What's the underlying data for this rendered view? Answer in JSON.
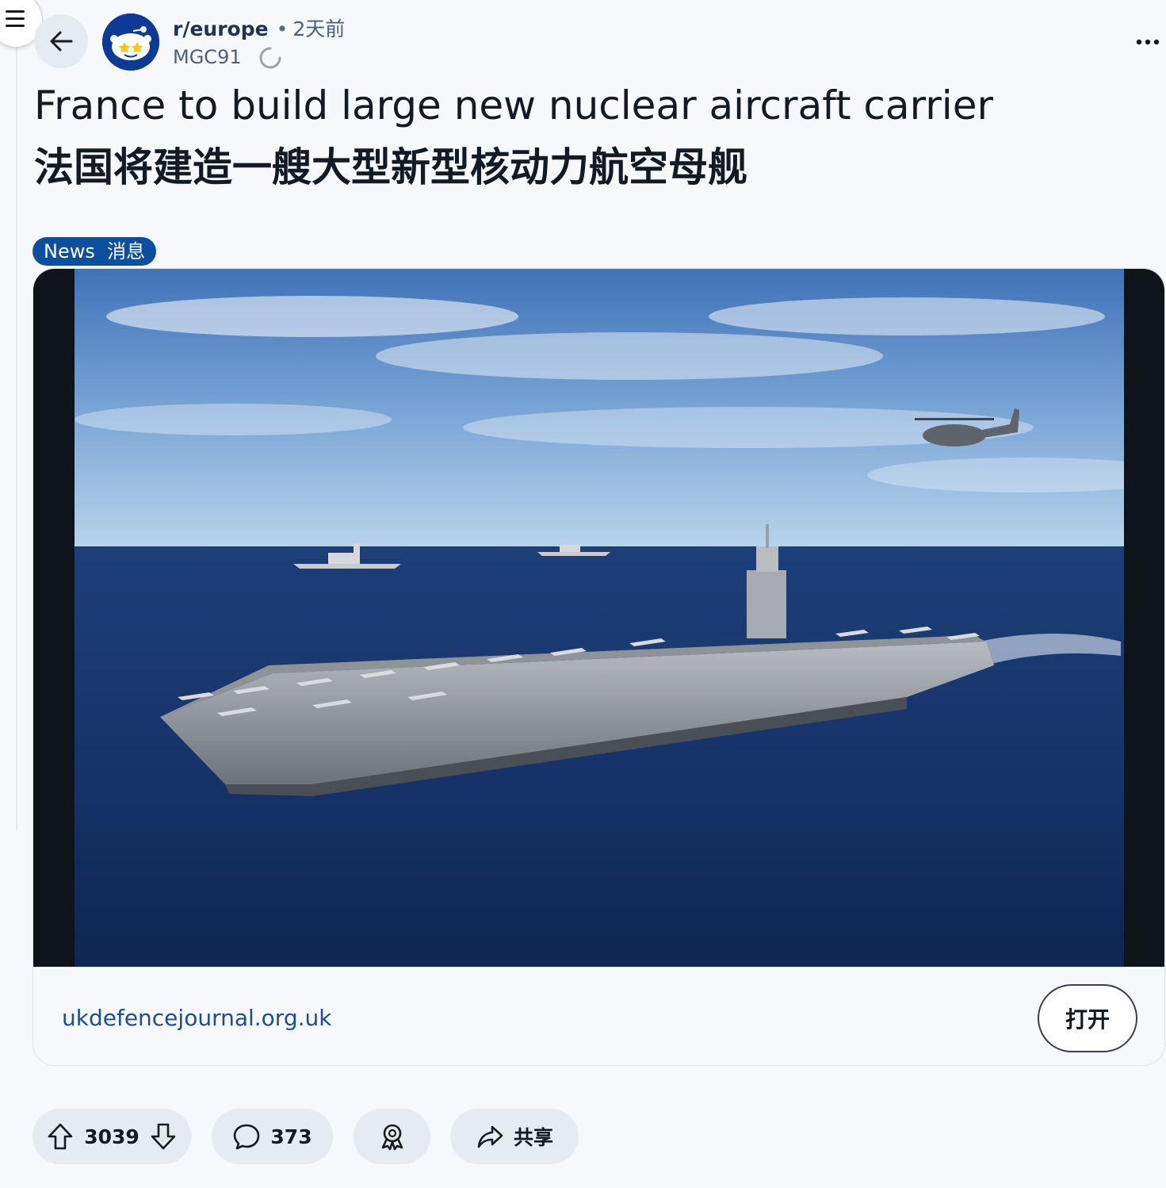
{
  "header": {
    "subreddit": "r/europe",
    "separator": "•",
    "time": "2天前",
    "author": "MGC91"
  },
  "post": {
    "title_en": "France to build large new nuclear aircraft carrier",
    "title_zh": "法国将建造一艘大型新型核动力航空母舰",
    "flair": "News  消息"
  },
  "link": {
    "domain": "ukdefencejournal.org.uk",
    "open_label": "打开"
  },
  "actions": {
    "score": "3039",
    "comments": "373",
    "share_label": "共享"
  },
  "icons": {
    "menu": "hamburger-icon",
    "back": "arrow-left-icon",
    "more": "ellipsis-icon",
    "upvote": "arrow-up-icon",
    "downvote": "arrow-down-icon",
    "comment": "speech-bubble-icon",
    "award": "award-icon",
    "share": "share-arrow-icon"
  },
  "colors": {
    "flair_bg": "#0d4f9c",
    "link": "#1c4f8f",
    "pill_bg": "#e6ebf2",
    "avatar_bg": "#0c3a96"
  }
}
